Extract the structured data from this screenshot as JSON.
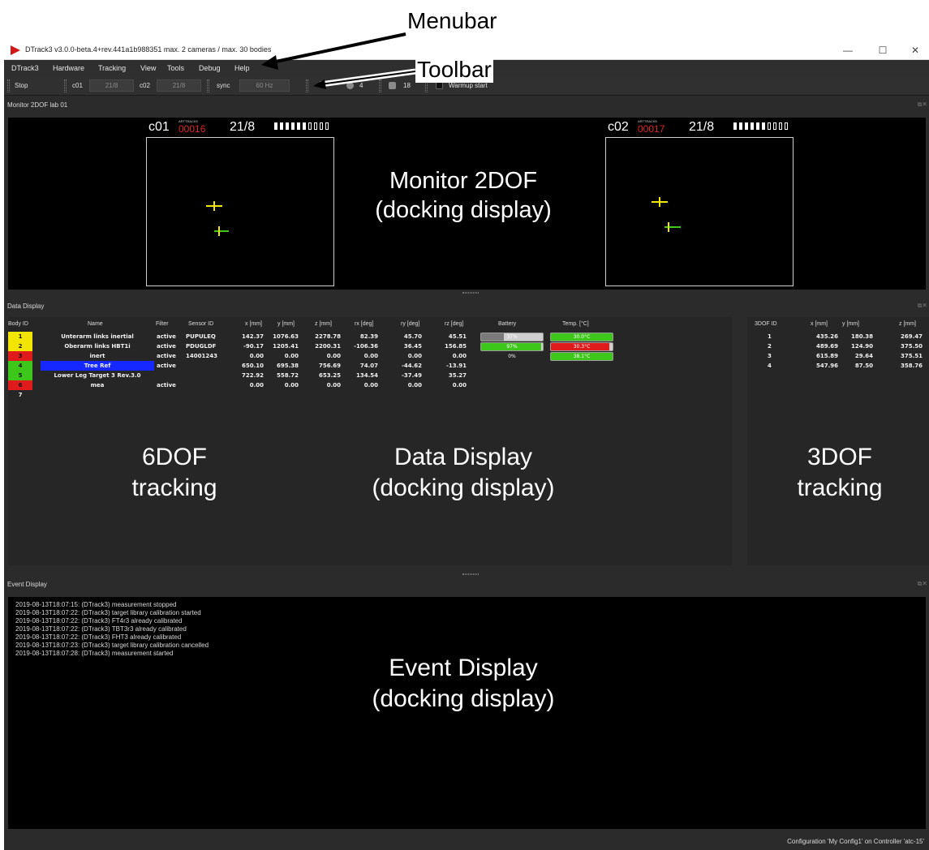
{
  "annotations": {
    "menubar": "Menubar",
    "toolbar": "Toolbar"
  },
  "window": {
    "title": "DTrack3 v3.0.0-beta.4+rev.441a1b988351 max. 2 cameras / max. 30 bodies",
    "minimize_glyph": "—",
    "maximize_glyph": "☐",
    "close_glyph": "✕",
    "app_icon": "dtrack-logo-icon"
  },
  "menubar": {
    "items": [
      "DTrack3",
      "Hardware",
      "Tracking",
      "View",
      "Tools",
      "Debug",
      "Help"
    ]
  },
  "toolbar": {
    "stop_label": "Stop",
    "cam1_label": "c01",
    "cam1_value": "21/8",
    "cam2_label": "c02",
    "cam2_value": "21/8",
    "sync_label": "sync",
    "sync_value": "60 Hz",
    "count_a": "4",
    "count_b": "18",
    "warmup_label": "Warmup start"
  },
  "monitor": {
    "title": "Monitor 2DOF lab 01",
    "overlay_line1": "Monitor 2DOF",
    "overlay_line2": "(docking display)",
    "cameras": [
      {
        "name": "c01",
        "small_label": "ARTTRACK5",
        "count": "00016",
        "ratio": "21/8",
        "bars_filled": 6,
        "bars_empty": 4
      },
      {
        "name": "c02",
        "small_label": "ARTTRACK5",
        "count": "00017",
        "ratio": "21/8",
        "bars_filled": 6,
        "bars_empty": 4
      }
    ]
  },
  "data_display": {
    "title": "Data Display",
    "overlay_left_1": "6DOF",
    "overlay_left_2": "tracking",
    "overlay_mid_1": "Data Display",
    "overlay_mid_2": "(docking display)",
    "overlay_right_1": "3DOF",
    "overlay_right_2": "tracking",
    "headers": {
      "body_id": "Body ID",
      "name": "Name",
      "filter": "Filter",
      "sensor_id": "Sensor ID",
      "x": "x [mm]",
      "y": "y [mm]",
      "z": "z [mm]",
      "rx": "rx [deg]",
      "ry": "ry [deg]",
      "rz": "rz [deg]",
      "battery": "Battery",
      "temp": "Temp. [°C]"
    },
    "rows": [
      {
        "id": "1",
        "id_color": "#f2e600",
        "name": "Unterarm links inertial",
        "filter": "active",
        "sensor": "PUPULEQ",
        "x": "142.37",
        "y": "1076.63",
        "z": "2278.78",
        "rx": "82.39",
        "ry": "45.70",
        "rz": "45.51",
        "battery": "37%",
        "battery_level": 0.37,
        "battery_color": "#7a7a7a",
        "temp": "30.0°C",
        "temp_level": 1.0,
        "temp_color": "#3ec71b"
      },
      {
        "id": "2",
        "id_color": "#f2e600",
        "name": "Oberarm links HBT1i",
        "filter": "active",
        "sensor": "PDUGLDF",
        "x": "-90.17",
        "y": "1205.41",
        "z": "2200.31",
        "rx": "-106.36",
        "ry": "36.45",
        "rz": "156.85",
        "battery": "97%",
        "battery_level": 0.97,
        "battery_color": "#3ec71b",
        "temp": "30.3°C",
        "temp_level": 0.95,
        "temp_color": "#e01b1b"
      },
      {
        "id": "3",
        "id_color": "#e01b1b",
        "name": "inert",
        "filter": "active",
        "sensor": "14001243",
        "x": "0.00",
        "y": "0.00",
        "z": "0.00",
        "rx": "0.00",
        "ry": "0.00",
        "rz": "0.00",
        "battery": "0%",
        "battery_level": 0.0,
        "battery_color": "#262626",
        "temp": "38.1°C",
        "temp_level": 1.0,
        "temp_color": "#3ec71b"
      },
      {
        "id": "4",
        "id_color": "#3ec71b",
        "name": "Tree Ref",
        "name_bg": "#1428ff",
        "filter": "active",
        "sensor": "",
        "x": "650.10",
        "y": "695.38",
        "z": "756.69",
        "rx": "74.07",
        "ry": "-44.62",
        "rz": "-13.91"
      },
      {
        "id": "5",
        "id_color": "#3ec71b",
        "name": "Lower Leg Target 3 Rev.3.0",
        "filter": "",
        "sensor": "",
        "x": "722.92",
        "y": "558.72",
        "z": "653.25",
        "rx": "134.54",
        "ry": "-37.49",
        "rz": "35.27"
      },
      {
        "id": "6",
        "id_color": "#e01b1b",
        "name": "mea",
        "filter": "active",
        "sensor": "",
        "x": "0.00",
        "y": "0.00",
        "z": "0.00",
        "rx": "0.00",
        "ry": "0.00",
        "rz": "0.00"
      },
      {
        "id": "7",
        "id_color": "",
        "name": "",
        "filter": "",
        "sensor": "",
        "x": "",
        "y": "",
        "z": "",
        "rx": "",
        "ry": "",
        "rz": ""
      }
    ],
    "dof3_headers": {
      "id": "3DOF ID",
      "x": "x [mm]",
      "y": "y [mm]",
      "z": "z [mm]"
    },
    "dof3_rows": [
      {
        "id": "1",
        "x": "435.26",
        "y": "180.38",
        "z": "269.47"
      },
      {
        "id": "2",
        "x": "489.69",
        "y": "124.90",
        "z": "375.50"
      },
      {
        "id": "3",
        "x": "615.89",
        "y": "29.64",
        "z": "375.51"
      },
      {
        "id": "4",
        "x": "547.96",
        "y": "87.50",
        "z": "358.76"
      }
    ]
  },
  "event_display": {
    "title": "Event Display",
    "overlay_line1": "Event Display",
    "overlay_line2": "(docking display)",
    "lines": [
      "2019-08-13T18:07:15: (DTrack3) measurement stopped",
      "2019-08-13T18:07:22: (DTrack3) target library calibration started",
      "2019-08-13T18:07:22: (DTrack3) FT4r3 already calibrated",
      "2019-08-13T18:07:22: (DTrack3) TBT3r3 already calibrated",
      "2019-08-13T18:07:22: (DTrack3) FHT3 already calibrated",
      "2019-08-13T18:07:23: (DTrack3) target library calibration cancelled",
      "2019-08-13T18:07:28: (DTrack3) measurement started"
    ]
  },
  "statusbar": {
    "text": "Configuration 'My Config1' on Controller 'atc-15'"
  }
}
